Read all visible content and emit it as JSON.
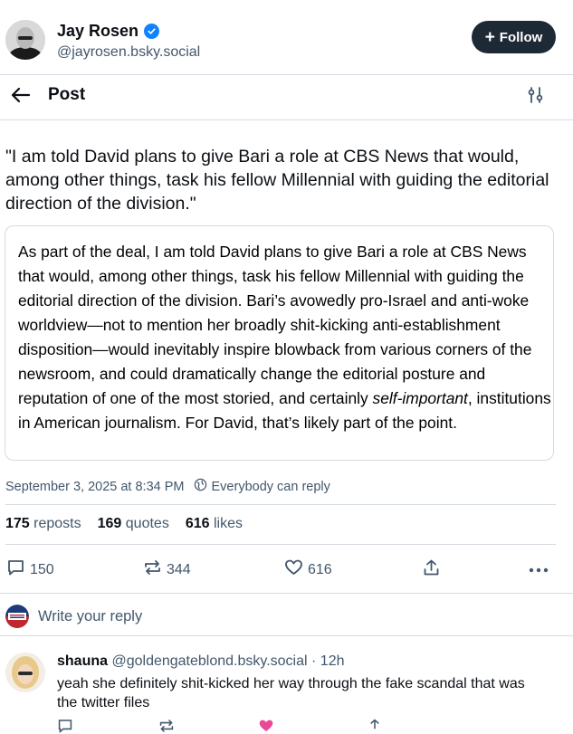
{
  "author": {
    "name": "Jay Rosen",
    "handle": "@jayrosen.bsky.social",
    "follow_label": "Follow"
  },
  "topbar": {
    "title": "Post"
  },
  "post": {
    "text": "\"I am told David plans to give Bari a role at CBS News that would, among other things, task his fellow Millennial with guiding the editorial direction of the division.\"",
    "quote_before": "As part of the deal, I am told David plans to give Bari a role at CBS News that would, among other things, task his fellow Millennial with guiding the editorial direction of the division. Bari’s avowedly pro-Israel and anti-woke worldview—not to mention her broadly shit-kicking anti-establishment disposition—would inevitably inspire blowback from various corners of the newsroom, and could dramatically change the editorial posture and reputation of one of the most storied, and certainly ",
    "quote_italic": "self-important",
    "quote_after": ", institutions in American journalism. For David, that’s likely part of the point.",
    "timestamp": "September 3, 2025 at 8:34 PM",
    "reply_setting": "Everybody can reply"
  },
  "stats": {
    "reposts_count": "175",
    "reposts_label": "reposts",
    "quotes_count": "169",
    "quotes_label": "quotes",
    "likes_count": "616",
    "likes_label": "likes"
  },
  "actions": {
    "reply_count": "150",
    "repost_count": "344",
    "like_count": "616"
  },
  "compose": {
    "placeholder": "Write your reply"
  },
  "reply": {
    "name": "shauna",
    "handle": "@goldengateblond.bsky.social",
    "separator": "·",
    "time": "12h",
    "text": "yeah she definitely shit-kicked her way through the fake scandal that was the twitter files"
  },
  "colors": {
    "accent": "#1083fe",
    "follow_bg": "#1e2936",
    "muted": "#42576c",
    "divider": "#d4dbe2",
    "like_pink": "#ec4899"
  }
}
